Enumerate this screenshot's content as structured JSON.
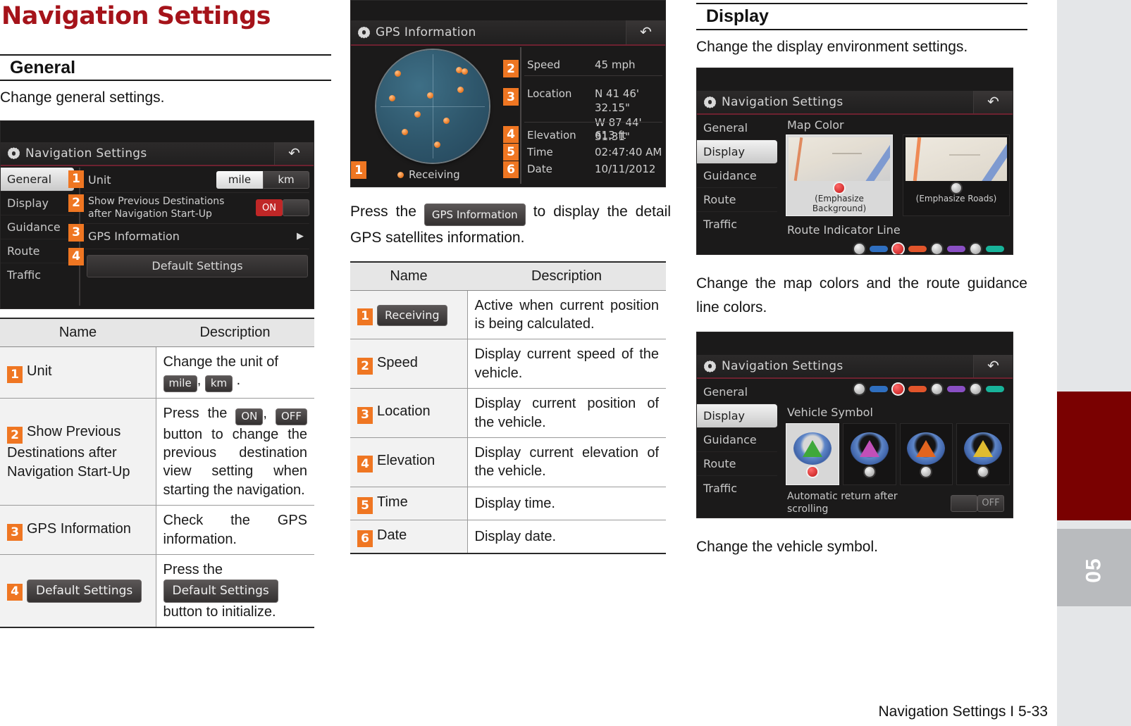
{
  "chapter": {
    "title": "Navigation Settings"
  },
  "footer": {
    "text": "Navigation Settings I 5-33"
  },
  "edge_tab": {
    "number": "05"
  },
  "general": {
    "heading": "General",
    "intro": "Change general settings.",
    "screenshot": {
      "title": "Navigation Settings",
      "back_icon": "back-arrow-icon",
      "gear_icon": "gear-icon",
      "menu": [
        "General",
        "Display",
        "Guidance",
        "Route",
        "Traffic"
      ],
      "active_menu": "General",
      "rows": [
        {
          "badge": "1",
          "label": "Unit",
          "options": [
            "mile",
            "km"
          ],
          "selected": "mile"
        },
        {
          "badge": "2",
          "label": "Show Previous Destinations\nafter Navigation Start-Up",
          "toggle": "ON"
        },
        {
          "badge": "3",
          "label": "GPS Information",
          "chevron": "chevron-right-icon"
        },
        {
          "badge": "4",
          "label": "Default Settings"
        }
      ]
    },
    "table": {
      "headers": [
        "Name",
        "Description"
      ],
      "rows": [
        {
          "num": "1",
          "name": "Unit",
          "desc_parts": [
            {
              "type": "text",
              "value": "Change the unit of "
            },
            {
              "type": "button",
              "value": "mile"
            },
            {
              "type": "text",
              "value": ", "
            },
            {
              "type": "button",
              "value": "km"
            },
            {
              "type": "text",
              "value": " ."
            }
          ]
        },
        {
          "num": "2",
          "name": "Show Previous Destinations after Navigation Start-Up",
          "desc_parts": [
            {
              "type": "text",
              "value": "Press the "
            },
            {
              "type": "button",
              "value": "ON"
            },
            {
              "type": "text",
              "value": ", "
            },
            {
              "type": "button",
              "value": "OFF"
            },
            {
              "type": "text",
              "value": " button to change the previous destination view setting when starting the navigation."
            }
          ]
        },
        {
          "num": "3",
          "name": "GPS Information",
          "desc_parts": [
            {
              "type": "text",
              "value": "Check the GPS information."
            }
          ]
        },
        {
          "num": "4",
          "name_button": "Default Settings",
          "desc_parts": [
            {
              "type": "text",
              "value": "Press the "
            },
            {
              "type": "button",
              "value": "Default Settings"
            },
            {
              "type": "text",
              "value": " button to initialize."
            }
          ]
        }
      ]
    }
  },
  "gps": {
    "screenshot": {
      "title": "GPS Information",
      "gear_icon": "gear-icon",
      "back_icon": "back-arrow-icon",
      "receiving_label": "Receiving",
      "fields": [
        {
          "badge": "2",
          "label": "Speed",
          "value": "45 mph"
        },
        {
          "badge": "3",
          "label": "Location",
          "value": "N 41 46' 32.15\"\nW 87 44' 31.31\""
        },
        {
          "badge": "4",
          "label": "Elevation",
          "value": "613 ft"
        },
        {
          "badge": "5",
          "label": "Time",
          "value": "02:47:40 AM"
        },
        {
          "badge": "6",
          "label": "Date",
          "value": "10/11/2012"
        }
      ],
      "receiving_badge": "1"
    },
    "caption_parts": [
      {
        "type": "text",
        "value": "Press the "
      },
      {
        "type": "button",
        "value": "GPS Information"
      },
      {
        "type": "text",
        "value": " to display the detail GPS satellites information."
      }
    ],
    "table": {
      "headers": [
        "Name",
        "Description"
      ],
      "rows": [
        {
          "num": "1",
          "name_button": "Receiving",
          "desc": "Active when current position is being calculated."
        },
        {
          "num": "2",
          "name": "Speed",
          "desc": "Display current speed of the vehicle."
        },
        {
          "num": "3",
          "name": "Location",
          "desc": "Display current position of the vehicle."
        },
        {
          "num": "4",
          "name": "Elevation",
          "desc": "Display current elevation of the vehicle."
        },
        {
          "num": "5",
          "name": "Time",
          "desc": "Display time."
        },
        {
          "num": "6",
          "name": "Date",
          "desc": "Display date."
        }
      ]
    }
  },
  "display": {
    "heading": "Display",
    "intro": "Change the display environment settings.",
    "screenshot_map_color": {
      "title": "Navigation Settings",
      "gear_icon": "gear-icon",
      "back_icon": "back-arrow-icon",
      "menu": [
        "General",
        "Display",
        "Guidance",
        "Route",
        "Traffic"
      ],
      "active_menu": "Display",
      "section_label": "Map Color",
      "options": [
        {
          "caption": "(Emphasize Background)",
          "selected": true
        },
        {
          "caption": "(Emphasize Roads)",
          "selected": false
        }
      ],
      "route_line_label": "Route Indicator Line",
      "route_line_colors": [
        "#2f6fc0",
        "#e2552b",
        "#8a4fc4",
        "#18b39a"
      ]
    },
    "caption_1": "Change the map colors and the route guidance line colors.",
    "screenshot_vehicle_symbol": {
      "title": "Navigation Settings",
      "gear_icon": "gear-icon",
      "back_icon": "back-arrow-icon",
      "menu": [
        "General",
        "Display",
        "Guidance",
        "Route",
        "Traffic"
      ],
      "active_menu": "Display",
      "route_line_colors": [
        "#2f6fc0",
        "#e2552b",
        "#8a4fc4",
        "#18b39a"
      ],
      "section_label": "Vehicle Symbol",
      "symbols": [
        {
          "color": "#3fa83b",
          "selected": true
        },
        {
          "color": "#c24fb8",
          "selected": false
        },
        {
          "color": "#e2651f",
          "selected": false
        },
        {
          "color": "#e0bb30",
          "selected": false
        }
      ],
      "auto_return_label": "Automatic return after\nscrolling",
      "auto_return_value": "OFF"
    },
    "caption_2": "Change the vehicle symbol."
  },
  "colors": {
    "accent_red": "#a5131a",
    "badge_orange": "#ef7622",
    "tab_current": "#7a0101"
  }
}
